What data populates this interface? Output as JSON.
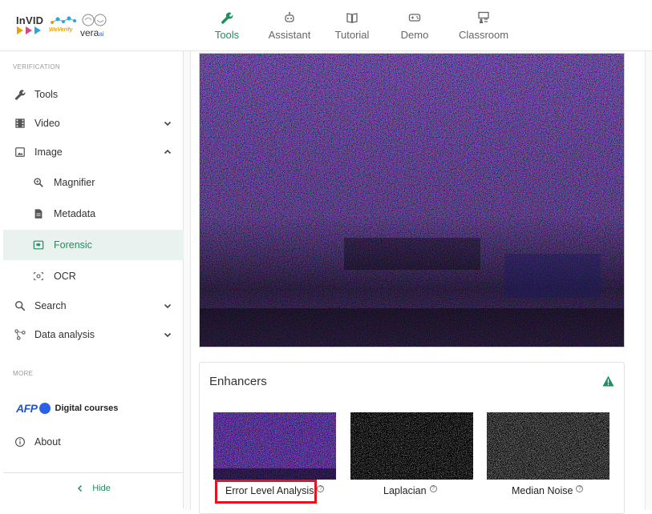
{
  "brand": {
    "invid": "InVID",
    "weverify": "WeVerify",
    "vera": "vera",
    "vera_suffix": "ai"
  },
  "topnav": [
    {
      "label": "Tools",
      "icon": "wrench-icon",
      "active": true
    },
    {
      "label": "Assistant",
      "icon": "robot-icon",
      "active": false
    },
    {
      "label": "Tutorial",
      "icon": "book-icon",
      "active": false
    },
    {
      "label": "Demo",
      "icon": "gamepad-icon",
      "active": false
    },
    {
      "label": "Classroom",
      "icon": "classroom-icon",
      "active": false
    }
  ],
  "sidebar": {
    "section_verification": "VERIFICATION",
    "items": [
      {
        "label": "Tools",
        "icon": "wrench-icon"
      },
      {
        "label": "Video",
        "icon": "film-icon",
        "chevron": "down"
      },
      {
        "label": "Image",
        "icon": "image-icon",
        "chevron": "up"
      },
      {
        "label": "Magnifier",
        "icon": "magnifier-icon"
      },
      {
        "label": "Metadata",
        "icon": "document-icon"
      },
      {
        "label": "Forensic",
        "icon": "forensic-icon",
        "active": true
      },
      {
        "label": "OCR",
        "icon": "ocr-icon"
      },
      {
        "label": "Search",
        "icon": "search-icon",
        "chevron": "down"
      },
      {
        "label": "Data analysis",
        "icon": "graph-icon",
        "chevron": "down"
      }
    ],
    "section_more": "MORE",
    "afp_logo": "AFP",
    "digital_courses": "Digital courses",
    "about": "About",
    "hide": "Hide"
  },
  "enhancers": {
    "title": "Enhancers",
    "items": [
      {
        "label": "Error Level Analysis",
        "highlighted": true
      },
      {
        "label": "Laplacian",
        "highlighted": false
      },
      {
        "label": "Median Noise",
        "highlighted": false
      }
    ]
  },
  "colors": {
    "accent": "#1f8f5f",
    "highlight_box": "#e01422",
    "active_bg": "#e9f2ee"
  }
}
